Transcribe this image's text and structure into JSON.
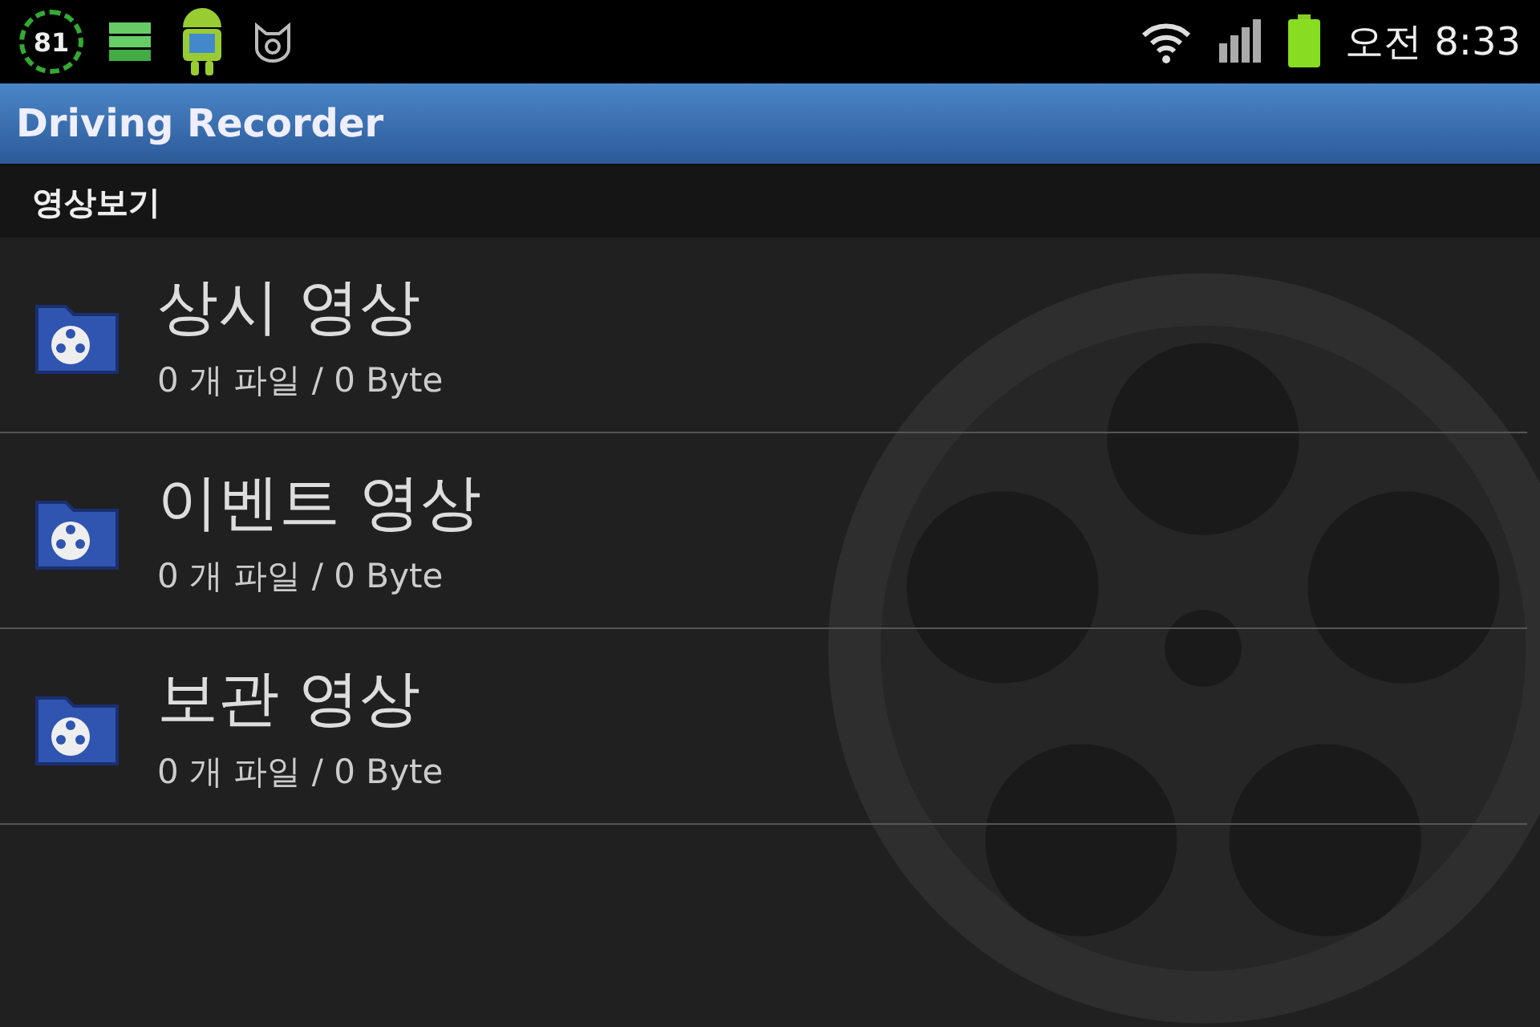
{
  "status_bar": {
    "badge": "81",
    "time": "오전 8:33"
  },
  "window": {
    "title": "Driving Recorder"
  },
  "section": {
    "title": "영상보기"
  },
  "items": [
    {
      "title": "상시 영상",
      "subtitle": "0 개 파일 / 0 Byte"
    },
    {
      "title": "이벤트 영상",
      "subtitle": "0 개 파일 / 0 Byte"
    },
    {
      "title": "보관 영상",
      "subtitle": "0 개 파일 / 0 Byte"
    }
  ]
}
